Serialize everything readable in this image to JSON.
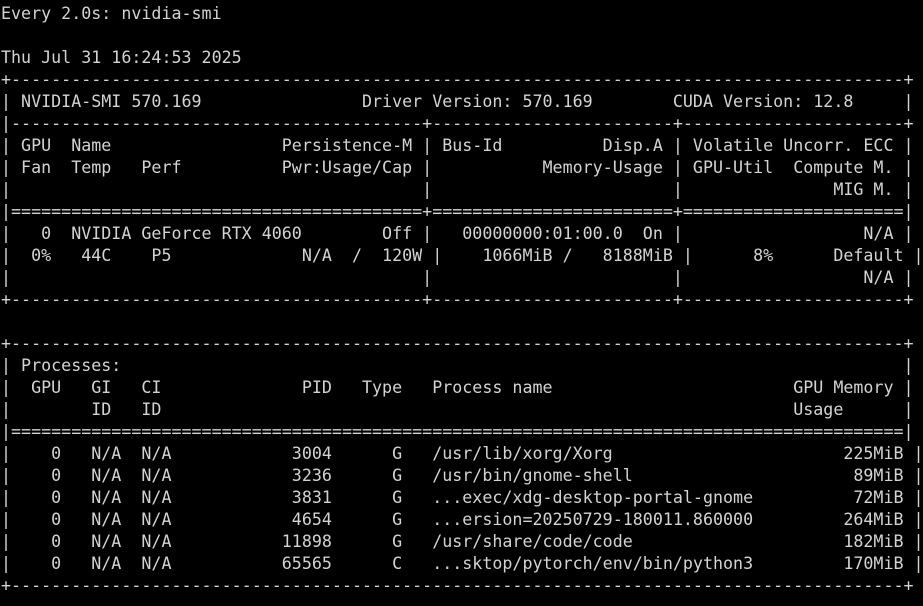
{
  "terminal": {
    "lines": [
      "Every 2.0s: nvidia-smi",
      "",
      "Thu Jul 31 16:24:53 2025",
      "+-----------------------------------------------------------------------------------------+",
      "| NVIDIA-SMI 570.169                Driver Version: 570.169        CUDA Version: 12.8     |",
      "|-----------------------------------------+------------------------+----------------------+",
      "| GPU  Name                 Persistence-M | Bus-Id          Disp.A | Volatile Uncorr. ECC |",
      "| Fan  Temp   Perf          Pwr:Usage/Cap |           Memory-Usage | GPU-Util  Compute M. |",
      "|                                         |                        |               MIG M. |",
      "|=========================================+========================+======================|",
      "|   0  NVIDIA GeForce RTX 4060        Off |   00000000:01:00.0  On |                  N/A |",
      "|  0%   44C    P5             N/A  /  120W |    1066MiB /   8188MiB |      8%      Default |",
      "|                                         |                        |                  N/A |",
      "+-----------------------------------------+------------------------+----------------------+",
      "",
      "+-----------------------------------------------------------------------------------------+",
      "| Processes:                                                                              |",
      "|  GPU   GI   CI              PID   Type   Process name                        GPU Memory |",
      "|        ID   ID                                                               Usage      |",
      "|=========================================================================================|",
      "|    0   N/A  N/A            3004      G   /usr/lib/xorg/Xorg                       225MiB |",
      "|    0   N/A  N/A            3236      G   /usr/bin/gnome-shell                      89MiB |",
      "|    0   N/A  N/A            3831      G   ...exec/xdg-desktop-portal-gnome          72MiB |",
      "|    0   N/A  N/A            4654      G   ...ersion=20250729-180011.860000         264MiB |",
      "|    0   N/A  N/A           11898      G   /usr/share/code/code                     182MiB |",
      "|    0   N/A  N/A           65565      C   ...sktop/pytorch/env/bin/python3         170MiB |",
      "+-----------------------------------------------------------------------------------------+"
    ]
  }
}
